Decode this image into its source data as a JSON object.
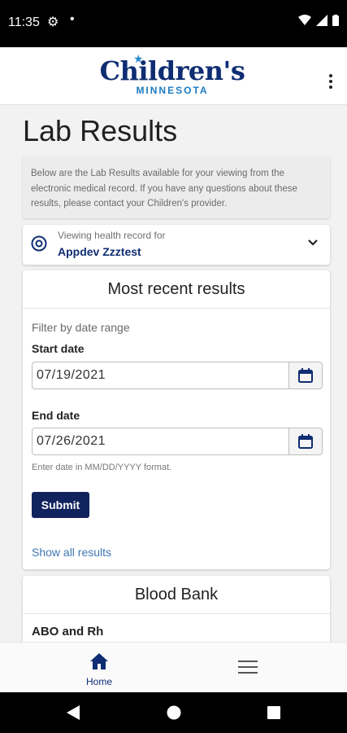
{
  "status_bar": {
    "time": "11:35",
    "dot": "•"
  },
  "app": {
    "logo_name": "Children's",
    "logo_sub": "MINNESOTA"
  },
  "page": {
    "title": "Lab Results",
    "intro": "Below are the Lab Results available for your viewing from the electronic medical record. If you have any questions about these results, please contact your Children's provider."
  },
  "record": {
    "label": "Viewing health record for",
    "name": "Appdev Zzztest"
  },
  "recent": {
    "heading": "Most recent results",
    "filter_label": "Filter by date range",
    "start_label": "Start date",
    "start_value": "07/19/2021",
    "end_label": "End date",
    "end_value": "07/26/2021",
    "hint": "Enter date in MM/DD/YYYY format.",
    "submit": "Submit",
    "show_all": "Show all results"
  },
  "blood_bank": {
    "heading": "Blood Bank",
    "first_item": "ABO and Rh"
  },
  "bottom_nav": {
    "home": "Home"
  },
  "colors": {
    "brand_navy": "#0f2d72",
    "submit_bg": "#11235e",
    "link": "#3f77b3"
  }
}
